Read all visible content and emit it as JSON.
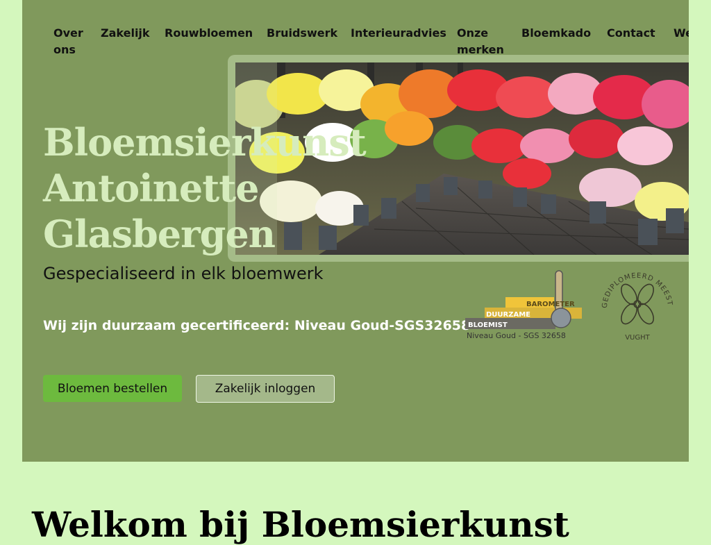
{
  "nav": {
    "items": [
      {
        "label": "Over ons"
      },
      {
        "label": "Zakelijk"
      },
      {
        "label": "Rouwbloemen"
      },
      {
        "label": "Bruidswerk"
      },
      {
        "label": "Interieuradvies"
      },
      {
        "label": "Onze merken"
      },
      {
        "label": "Bloemkado"
      },
      {
        "label": "Contact"
      },
      {
        "label": "Websh"
      }
    ]
  },
  "hero": {
    "title_lines": [
      "Bloemsierkunst",
      "Antoinette",
      "Glasbergen"
    ],
    "subtitle": "Gespecialiseerd in elk bloemwerk",
    "certification": "Wij zijn duurzaam gecertificeerd: Niveau Goud-SGS32658",
    "order_button": "Bloemen bestellen",
    "login_button": "Zakelijk inloggen"
  },
  "barometer_logo": {
    "word1": "BAROMETER",
    "word2": "DUURZAME",
    "word3": "BLOEMIST",
    "level": "Niveau Goud - SGS 32658"
  },
  "seal_logo": {
    "top_text": "GEDIPLOMEERD MEESTERBINDER",
    "bottom_text": "VUGHT"
  },
  "welcome": {
    "heading": "Welkom bij Bloemsierkunst"
  },
  "colors": {
    "page_bg": "#d4f7bd",
    "hero_bg": "#80995c",
    "title": "#d6ecbd",
    "primary_button": "#6dba3e",
    "secondary_button": "#a4b88a"
  }
}
